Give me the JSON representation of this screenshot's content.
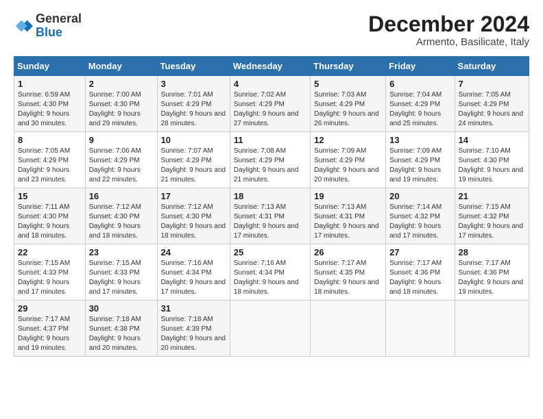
{
  "logo": {
    "general": "General",
    "blue": "Blue"
  },
  "title": "December 2024",
  "location": "Armento, Basilicate, Italy",
  "days_header": [
    "Sunday",
    "Monday",
    "Tuesday",
    "Wednesday",
    "Thursday",
    "Friday",
    "Saturday"
  ],
  "weeks": [
    [
      {
        "num": "1",
        "rise": "6:59 AM",
        "set": "4:30 PM",
        "daylight": "9 hours and 30 minutes."
      },
      {
        "num": "2",
        "rise": "7:00 AM",
        "set": "4:30 PM",
        "daylight": "9 hours and 29 minutes."
      },
      {
        "num": "3",
        "rise": "7:01 AM",
        "set": "4:29 PM",
        "daylight": "9 hours and 28 minutes."
      },
      {
        "num": "4",
        "rise": "7:02 AM",
        "set": "4:29 PM",
        "daylight": "9 hours and 27 minutes."
      },
      {
        "num": "5",
        "rise": "7:03 AM",
        "set": "4:29 PM",
        "daylight": "9 hours and 26 minutes."
      },
      {
        "num": "6",
        "rise": "7:04 AM",
        "set": "4:29 PM",
        "daylight": "9 hours and 25 minutes."
      },
      {
        "num": "7",
        "rise": "7:05 AM",
        "set": "4:29 PM",
        "daylight": "9 hours and 24 minutes."
      }
    ],
    [
      {
        "num": "8",
        "rise": "7:05 AM",
        "set": "4:29 PM",
        "daylight": "9 hours and 23 minutes."
      },
      {
        "num": "9",
        "rise": "7:06 AM",
        "set": "4:29 PM",
        "daylight": "9 hours and 22 minutes."
      },
      {
        "num": "10",
        "rise": "7:07 AM",
        "set": "4:29 PM",
        "daylight": "9 hours and 21 minutes."
      },
      {
        "num": "11",
        "rise": "7:08 AM",
        "set": "4:29 PM",
        "daylight": "9 hours and 21 minutes."
      },
      {
        "num": "12",
        "rise": "7:09 AM",
        "set": "4:29 PM",
        "daylight": "9 hours and 20 minutes."
      },
      {
        "num": "13",
        "rise": "7:09 AM",
        "set": "4:29 PM",
        "daylight": "9 hours and 19 minutes."
      },
      {
        "num": "14",
        "rise": "7:10 AM",
        "set": "4:30 PM",
        "daylight": "9 hours and 19 minutes."
      }
    ],
    [
      {
        "num": "15",
        "rise": "7:11 AM",
        "set": "4:30 PM",
        "daylight": "9 hours and 18 minutes."
      },
      {
        "num": "16",
        "rise": "7:12 AM",
        "set": "4:30 PM",
        "daylight": "9 hours and 18 minutes."
      },
      {
        "num": "17",
        "rise": "7:12 AM",
        "set": "4:30 PM",
        "daylight": "9 hours and 18 minutes."
      },
      {
        "num": "18",
        "rise": "7:13 AM",
        "set": "4:31 PM",
        "daylight": "9 hours and 17 minutes."
      },
      {
        "num": "19",
        "rise": "7:13 AM",
        "set": "4:31 PM",
        "daylight": "9 hours and 17 minutes."
      },
      {
        "num": "20",
        "rise": "7:14 AM",
        "set": "4:32 PM",
        "daylight": "9 hours and 17 minutes."
      },
      {
        "num": "21",
        "rise": "7:15 AM",
        "set": "4:32 PM",
        "daylight": "9 hours and 17 minutes."
      }
    ],
    [
      {
        "num": "22",
        "rise": "7:15 AM",
        "set": "4:33 PM",
        "daylight": "9 hours and 17 minutes."
      },
      {
        "num": "23",
        "rise": "7:15 AM",
        "set": "4:33 PM",
        "daylight": "9 hours and 17 minutes."
      },
      {
        "num": "24",
        "rise": "7:16 AM",
        "set": "4:34 PM",
        "daylight": "9 hours and 17 minutes."
      },
      {
        "num": "25",
        "rise": "7:16 AM",
        "set": "4:34 PM",
        "daylight": "9 hours and 18 minutes."
      },
      {
        "num": "26",
        "rise": "7:17 AM",
        "set": "4:35 PM",
        "daylight": "9 hours and 18 minutes."
      },
      {
        "num": "27",
        "rise": "7:17 AM",
        "set": "4:36 PM",
        "daylight": "9 hours and 18 minutes."
      },
      {
        "num": "28",
        "rise": "7:17 AM",
        "set": "4:36 PM",
        "daylight": "9 hours and 19 minutes."
      }
    ],
    [
      {
        "num": "29",
        "rise": "7:17 AM",
        "set": "4:37 PM",
        "daylight": "9 hours and 19 minutes."
      },
      {
        "num": "30",
        "rise": "7:18 AM",
        "set": "4:38 PM",
        "daylight": "9 hours and 20 minutes."
      },
      {
        "num": "31",
        "rise": "7:18 AM",
        "set": "4:39 PM",
        "daylight": "9 hours and 20 minutes."
      },
      null,
      null,
      null,
      null
    ]
  ]
}
